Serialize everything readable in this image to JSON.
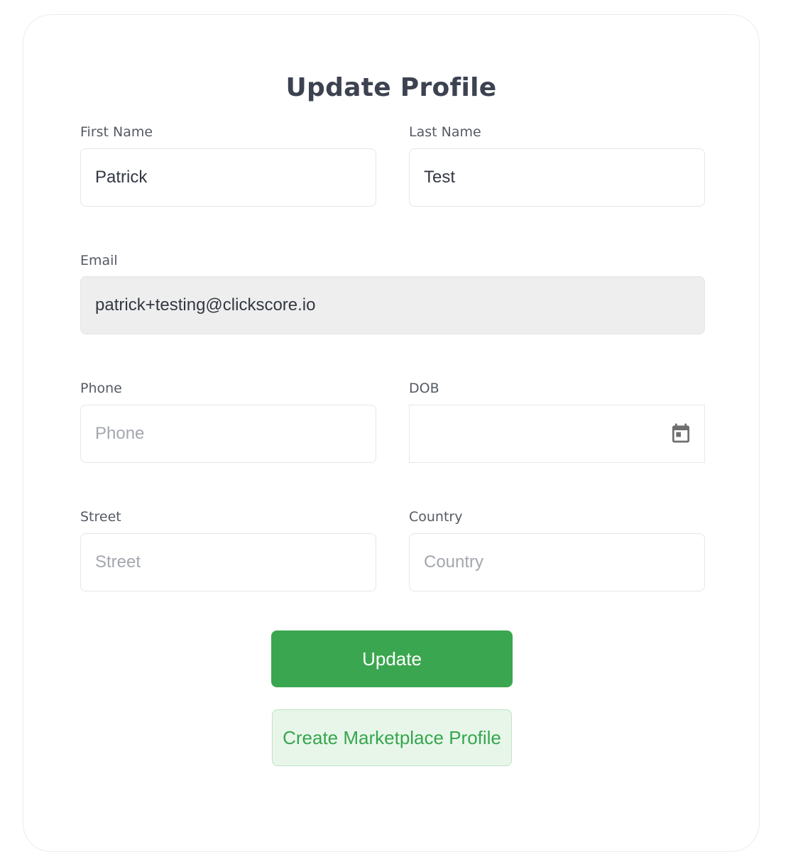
{
  "form": {
    "title": "Update Profile",
    "first_name": {
      "label": "First Name",
      "value": "Patrick"
    },
    "last_name": {
      "label": "Last Name",
      "value": "Test"
    },
    "email": {
      "label": "Email",
      "value": "patrick+testing@clickscore.io"
    },
    "phone": {
      "label": "Phone",
      "value": "",
      "placeholder": "Phone"
    },
    "dob": {
      "label": "DOB",
      "value": ""
    },
    "street": {
      "label": "Street",
      "value": "",
      "placeholder": "Street"
    },
    "country": {
      "label": "Country",
      "value": "",
      "placeholder": "Country"
    },
    "update_label": "Update",
    "marketplace_label": "Create Marketplace Profile"
  },
  "icons": {
    "dob_picker": "calendar-icon"
  },
  "colors": {
    "primary": "#3aa64f",
    "secondary_bg": "#e8f6ea",
    "secondary_text": "#36a64d",
    "disabled_bg": "#eeeeee"
  }
}
